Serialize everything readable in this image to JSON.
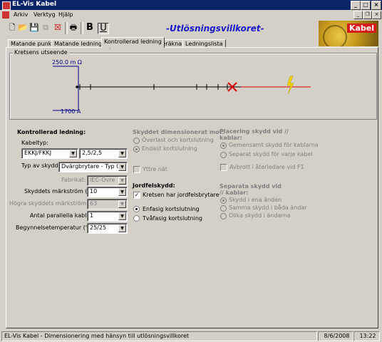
{
  "window": {
    "title": "EL-Vis Kabel",
    "minimize": "_",
    "maximize": "□",
    "close": "×"
  },
  "menu": {
    "items": [
      "Arkiv",
      "Verktyg",
      "Hjälp"
    ],
    "mdi_min": "_",
    "mdi_restore": "❐",
    "mdi_close": "×"
  },
  "toolbar": {
    "heading": "-Utlösningsvillkoret-",
    "bold_label": "B",
    "underline_label": "U",
    "logo_text": "Kabel"
  },
  "tabs": [
    "Matande punkt",
    "Matande ledningar",
    "Kontrollerad ledning",
    "Beräkna",
    "Ledningslista"
  ],
  "circuit": {
    "group_label": "Kretsens utseende",
    "impedance": "250.0 m Ω",
    "current": "1700 A"
  },
  "kontrollerad": {
    "title": "Kontrollerad ledning:",
    "kabeltyp_label": "Kabeltyp:",
    "kabeltyp_value": "EKKJ/FKKJ",
    "area_value": "2,5/2,5",
    "skydd_label": "Typ av skydd:",
    "skydd_value": "Dvärgbrytare - Typ C",
    "fabrikat_label": "Fabrikat:",
    "fabrikat_value": "IEC-Övre",
    "markstrom_label": "Skyddets märkström (A):",
    "markstrom_value": "10",
    "hogra_label": "Högra skyddets märkström (A):",
    "hogra_value": "63",
    "parallella_label": "Antal parallella kablar:",
    "parallella_value": "1",
    "temp_label": "Begynnelsetemperatur (°C):",
    "temp_value": "25/25"
  },
  "dimensionerat": {
    "title": "Skyddet dimensionerat mot:",
    "opt1": "Överlast och kortslutning",
    "opt2": "Endast kortslutning",
    "yttre": "Yttre nät"
  },
  "jordfel": {
    "title": "Jordfelskydd:",
    "check": "Kretsen har jordfelsbrytare",
    "opt1": "Enfasig kortslutning",
    "opt2": "Tvåfasig kortslutning"
  },
  "placering": {
    "title1": "Placering skydd vid //",
    "title2": "kablar:",
    "opt1": "Gemensamt skydd för kablarna",
    "opt2": "Separat skydd för varje kabel",
    "avbrott": "Avbrott i återledare vid F1"
  },
  "separata": {
    "title1": "Separata skydd vid",
    "title2": "// kablar:",
    "opt1": "Skydd i ena änden",
    "opt2": "Samma skydd i båda ändar",
    "opt3": "Olika skydd i ändarna"
  },
  "status": {
    "text": "EL-Vis Kabel - Dimensionering med hänsyn till utlösningsvillkoret",
    "date": "8/6/2008",
    "time": "13:22"
  }
}
